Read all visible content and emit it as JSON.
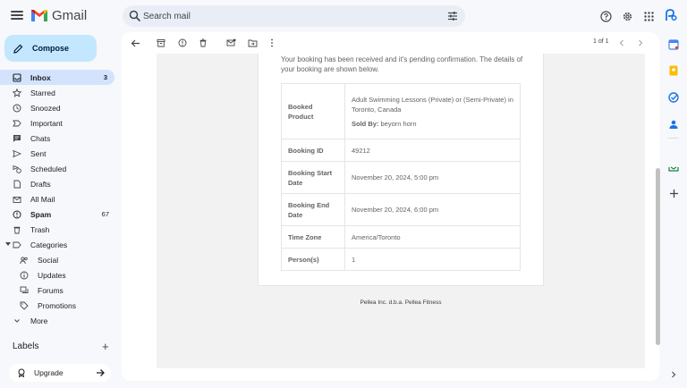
{
  "app": {
    "name": "Gmail"
  },
  "search": {
    "placeholder": "Search mail"
  },
  "compose": {
    "label": "Compose"
  },
  "nav": {
    "inbox": {
      "label": "Inbox",
      "count": "3"
    },
    "starred": {
      "label": "Starred"
    },
    "snoozed": {
      "label": "Snoozed"
    },
    "important": {
      "label": "Important"
    },
    "chats": {
      "label": "Chats"
    },
    "sent": {
      "label": "Sent"
    },
    "scheduled": {
      "label": "Scheduled"
    },
    "drafts": {
      "label": "Drafts"
    },
    "all_mail": {
      "label": "All Mail"
    },
    "spam": {
      "label": "Spam",
      "count": "67"
    },
    "trash": {
      "label": "Trash"
    },
    "categories": {
      "label": "Categories"
    },
    "social": {
      "label": "Social"
    },
    "updates": {
      "label": "Updates"
    },
    "forums": {
      "label": "Forums"
    },
    "promotions": {
      "label": "Promotions"
    },
    "more": {
      "label": "More"
    }
  },
  "labels": {
    "header": "Labels"
  },
  "upgrade": {
    "label": "Upgrade"
  },
  "pager": {
    "text": "1 of 1"
  },
  "email": {
    "intro_line1": "Your booking has been received and it's pending confirmation. The details of",
    "intro_line2": "your booking are shown below.",
    "rows": {
      "product_key": "Booked Product",
      "product_value": "Adult Swimming Lessons (Private) or (Semi-Private) in Toronto, Canada",
      "sold_by_key": "Sold By:",
      "sold_by_value": "beyorn horn",
      "booking_id_key": "Booking ID",
      "booking_id_value": "49212",
      "start_key": "Booking Start Date",
      "start_value": "November 20, 2024, 5:00 pm",
      "end_key": "Booking End Date",
      "end_value": "November 20, 2024, 6:00 pm",
      "tz_key": "Time Zone",
      "tz_value": "America/Toronto",
      "persons_key": "Person(s)",
      "persons_value": "1"
    },
    "footer": "Pellea Inc. d.b.a. Pellea Fitness"
  },
  "colors": {
    "accent": "#0b57d0",
    "compose_bg": "#c2e7ff",
    "active_nav": "#d3e3fd",
    "app_bg": "#f6f8fc"
  },
  "icons": [
    "hamburger-icon",
    "search-icon",
    "tune-icon",
    "help-icon",
    "gear-icon",
    "apps-icon",
    "pencil-icon",
    "back-arrow-icon",
    "archive-icon",
    "report-icon",
    "trash-icon",
    "mark-unread-icon",
    "move-to-icon",
    "more-vert-icon",
    "chevron-left-icon",
    "chevron-right-icon"
  ]
}
